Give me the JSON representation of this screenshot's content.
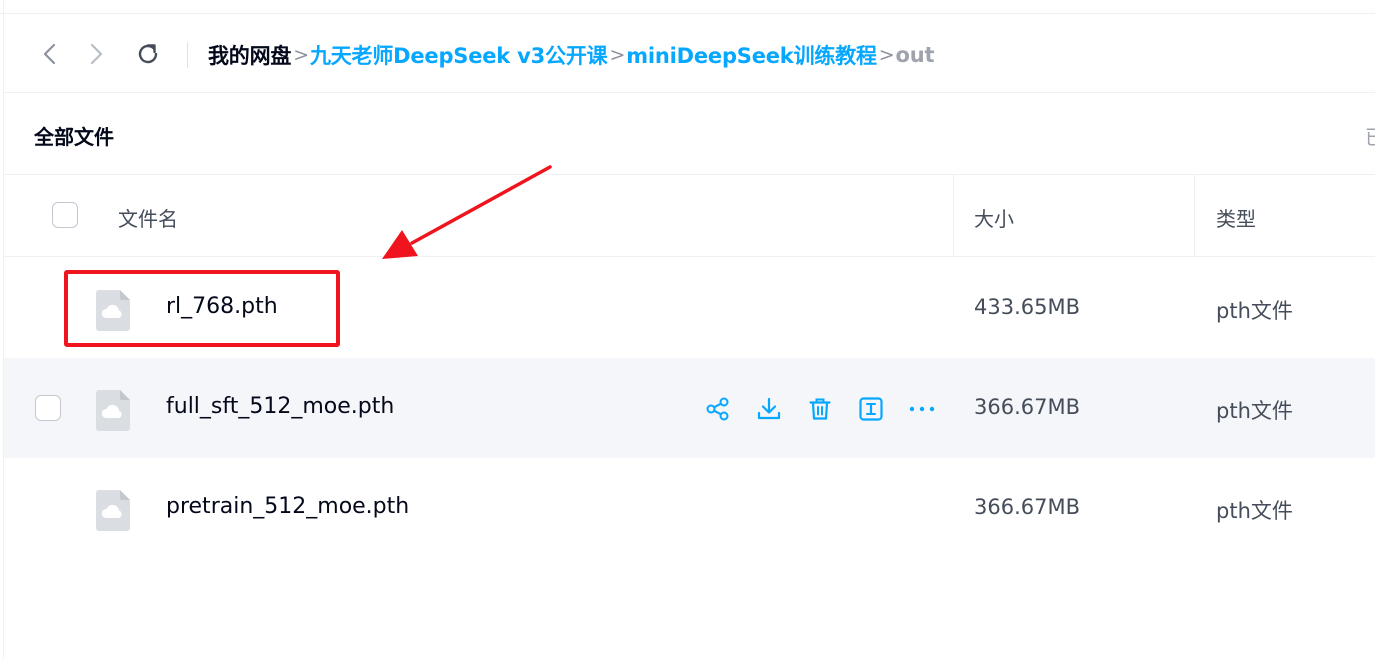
{
  "nav": {
    "back_icon": "chevron-left-icon",
    "forward_icon": "chevron-right-icon",
    "refresh_icon": "refresh-icon",
    "breadcrumb": {
      "root": "我的网盘",
      "sep": ">",
      "items": [
        "九天老师DeepSeek v3公开课",
        "miniDeepSeek训练教程"
      ],
      "current": "out"
    }
  },
  "section": {
    "title": "全部文件",
    "right_text": "已"
  },
  "table": {
    "columns": {
      "name": "文件名",
      "size": "大小",
      "type": "类型"
    },
    "rows": [
      {
        "name": "rl_768.pth",
        "size": "433.65MB",
        "type": "pth文件",
        "highlighted": true
      },
      {
        "name": "full_sft_512_moe.pth",
        "size": "366.67MB",
        "type": "pth文件",
        "hovered": true
      },
      {
        "name": "pretrain_512_moe.pth",
        "size": "366.67MB",
        "type": "pth文件"
      }
    ],
    "row_actions": [
      "share-icon",
      "download-icon",
      "trash-icon",
      "rename-icon",
      "more-icon"
    ]
  },
  "colors": {
    "accent": "#06a7ff",
    "annotation": "#f0141e",
    "hover_row": "#f5f6f9"
  }
}
